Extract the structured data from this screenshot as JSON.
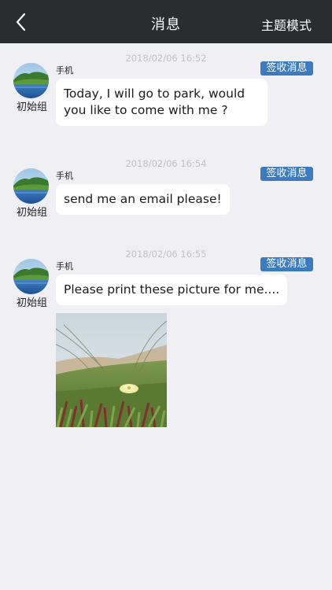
{
  "header": {
    "title": "消息",
    "action_label": "主题模式",
    "back_icon": "chevron-left-icon"
  },
  "colors": {
    "navbar": "#2b2c2e",
    "background": "#efeff4",
    "sign_button": "#3d7bc0",
    "bubble": "#ffffff"
  },
  "messages": [
    {
      "timestamp": "2018/02/06 16:52",
      "sign_label": "签收消息",
      "group_name": "初始组",
      "sender": "手机",
      "text": "Today, I will go to park, would you like to come with me ?"
    },
    {
      "timestamp": "2018/02/06 16:54",
      "sign_label": "签收消息",
      "group_name": "初始组",
      "sender": "手机",
      "text": "send me an email please!"
    },
    {
      "timestamp": "2018/02/06 16:55",
      "sign_label": "签收消息",
      "group_name": "初始组",
      "sender": "手机",
      "text": "Please print these picture for me...."
    }
  ]
}
